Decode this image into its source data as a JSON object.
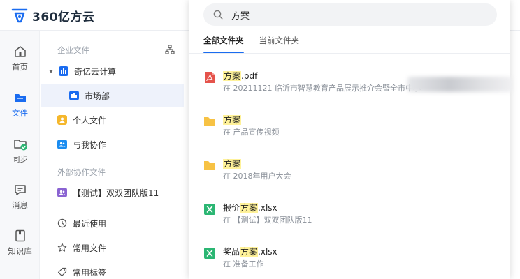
{
  "brand": {
    "name": "360亿方云"
  },
  "rail": {
    "items": [
      {
        "label": "首页",
        "icon": "home-icon"
      },
      {
        "label": "文件",
        "icon": "folder-icon",
        "active": true
      },
      {
        "label": "同步",
        "icon": "sync-folder-icon"
      },
      {
        "label": "消息",
        "icon": "message-icon"
      },
      {
        "label": "知识库",
        "icon": "book-icon"
      }
    ]
  },
  "tree": {
    "enterprise_title": "企业文件",
    "org_icon": "org-chart-icon",
    "root": "奇亿云计算",
    "child": "市场部",
    "personal": "个人文件",
    "shared": "与我协作",
    "external_title": "外部协作文件",
    "external_team": "【测试】双双团队版11",
    "recent": "最近使用",
    "frequent": "常用文件",
    "tags": "常用标签"
  },
  "search": {
    "query": "方案",
    "tabs": [
      {
        "label": "全部文件夹",
        "active": true
      },
      {
        "label": "当前文件夹",
        "active": false
      }
    ]
  },
  "results": [
    {
      "type": "pdf",
      "pre": "",
      "hit": "方案",
      "post": ".pdf",
      "path": "在 20211121 临沂市智慧教育产品展示推介会暨全市中小"
    },
    {
      "type": "folder",
      "pre": "",
      "hit": "方案",
      "post": "",
      "path": "在 产品宣传视频"
    },
    {
      "type": "folder",
      "pre": "",
      "hit": "方案",
      "post": "",
      "path": "在 2018年用户大会"
    },
    {
      "type": "xlsx",
      "pre": "报价",
      "hit": "方案",
      "post": ".xlsx",
      "path": "在 【测试】双双团队版11"
    },
    {
      "type": "xlsx",
      "pre": "奖品",
      "hit": "方案",
      "post": ".xlsx",
      "path": "在 准备工作"
    }
  ],
  "colors": {
    "accent": "#1a6cf0",
    "pdf": "#e5534b",
    "folder": "#f7c244",
    "xlsx": "#2bb673",
    "highlight": "#fff29a"
  }
}
